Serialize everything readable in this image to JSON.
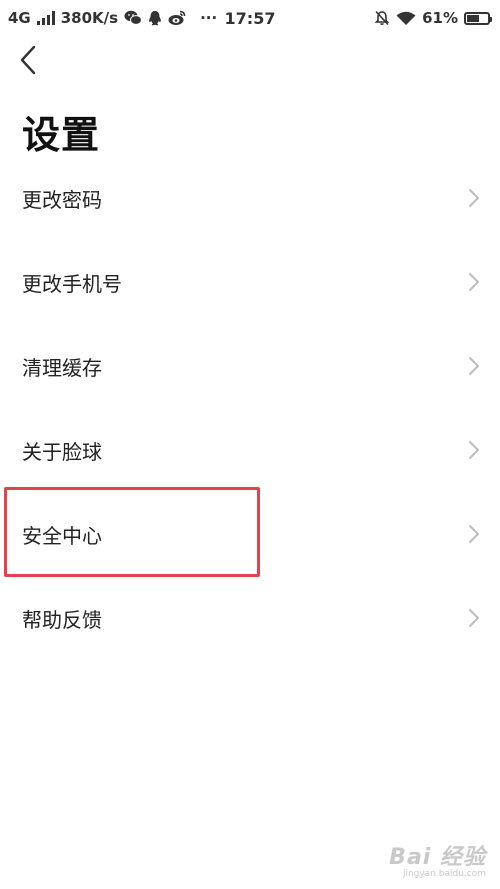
{
  "status_bar": {
    "network": "4G",
    "speed": "380K/s",
    "dots": "···",
    "time": "17:57",
    "battery": "61%",
    "battery_level": 0.61,
    "icons": [
      "signal-icon",
      "wechat-icon",
      "qq-icon",
      "weibo-icon",
      "mute-bell-icon",
      "wifi-icon",
      "battery-icon"
    ]
  },
  "header": {
    "back_icon": "chevron-left-icon",
    "title": "设置"
  },
  "settings": {
    "items": [
      {
        "label": "更改密码"
      },
      {
        "label": "更改手机号"
      },
      {
        "label": "清理缓存"
      },
      {
        "label": "关于脸球"
      },
      {
        "label": "安全中心"
      },
      {
        "label": "帮助反馈"
      }
    ],
    "chevron_icon": "chevron-right-icon"
  },
  "highlight": {
    "color": "#e0454e",
    "target": "安全中心"
  },
  "watermark": {
    "text": "Bai 经验",
    "url": "jingyan.baidu.com"
  }
}
